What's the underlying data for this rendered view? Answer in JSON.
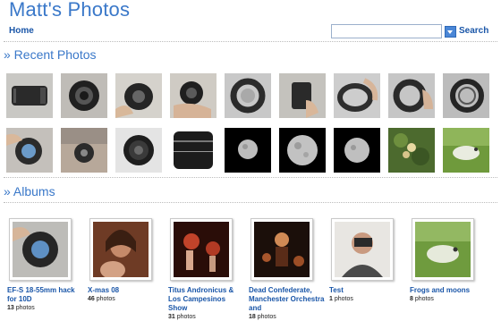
{
  "header": {
    "site_title": "Matt's Photos",
    "nav_home": "Home",
    "search_placeholder": "",
    "search_label": "Search"
  },
  "recent": {
    "title": "» Recent Photos"
  },
  "albums": {
    "title": "» Albums",
    "items": [
      {
        "title": "EF-S 18-55mm hack for 10D",
        "count": "13",
        "unit": "photos"
      },
      {
        "title": "X-mas 08",
        "count": "46",
        "unit": "photos"
      },
      {
        "title": "Titus Andronicus & Los Campesinos Show",
        "count": "31",
        "unit": "photos"
      },
      {
        "title": "Dead Confederate, Manchester Orchestra and",
        "count": "18",
        "unit": "photos"
      },
      {
        "title": "Test",
        "count": "1",
        "unit": "photos"
      },
      {
        "title": "Frogs and moons",
        "count": "8",
        "unit": "photos"
      }
    ]
  },
  "colors": {
    "accent": "#3a78c9",
    "link": "#1a56a8"
  }
}
